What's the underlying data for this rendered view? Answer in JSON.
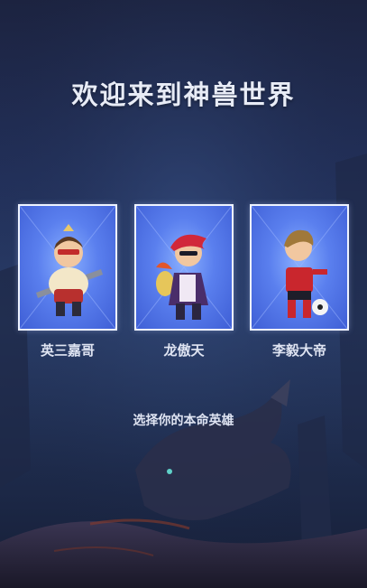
{
  "title": "欢迎来到神兽世界",
  "heroes": [
    {
      "name": "英三嘉哥"
    },
    {
      "name": "龙傲天"
    },
    {
      "name": "李毅大帝"
    }
  ],
  "prompt": "选择你的本命英雄"
}
